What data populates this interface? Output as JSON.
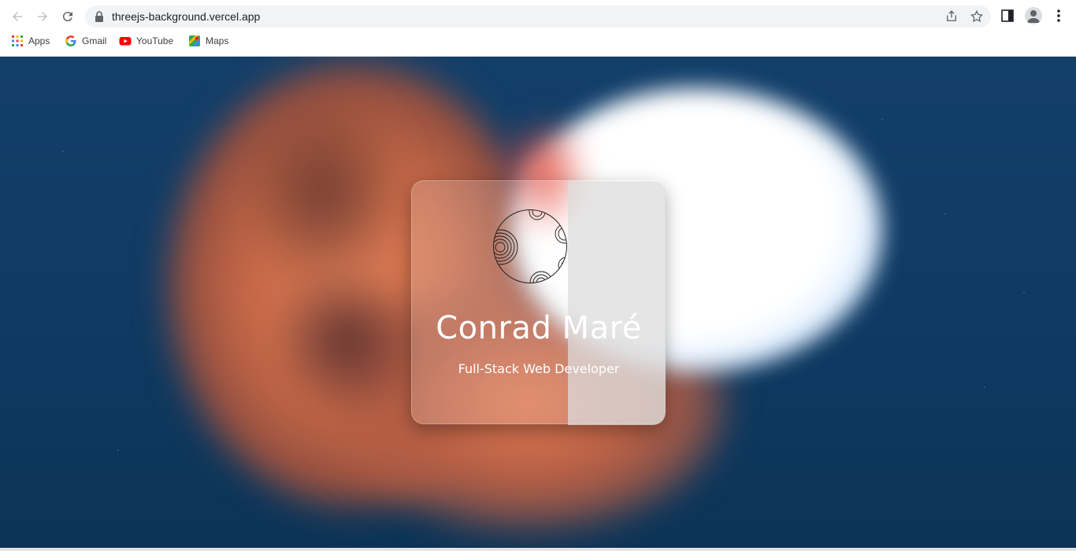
{
  "browser": {
    "url": "threejs-background.vercel.app",
    "bookmarks": [
      {
        "label": "Apps",
        "icon": "apps-grid-icon"
      },
      {
        "label": "Gmail",
        "icon": "google-icon"
      },
      {
        "label": "YouTube",
        "icon": "youtube-icon"
      },
      {
        "label": "Maps",
        "icon": "maps-icon"
      }
    ]
  },
  "card": {
    "name": "Conrad Maré",
    "role": "Full-Stack Web Developer"
  },
  "colors": {
    "background": "#0f3a63",
    "cloud_orange": "#f07a4f",
    "cloud_white": "#ffffff"
  }
}
